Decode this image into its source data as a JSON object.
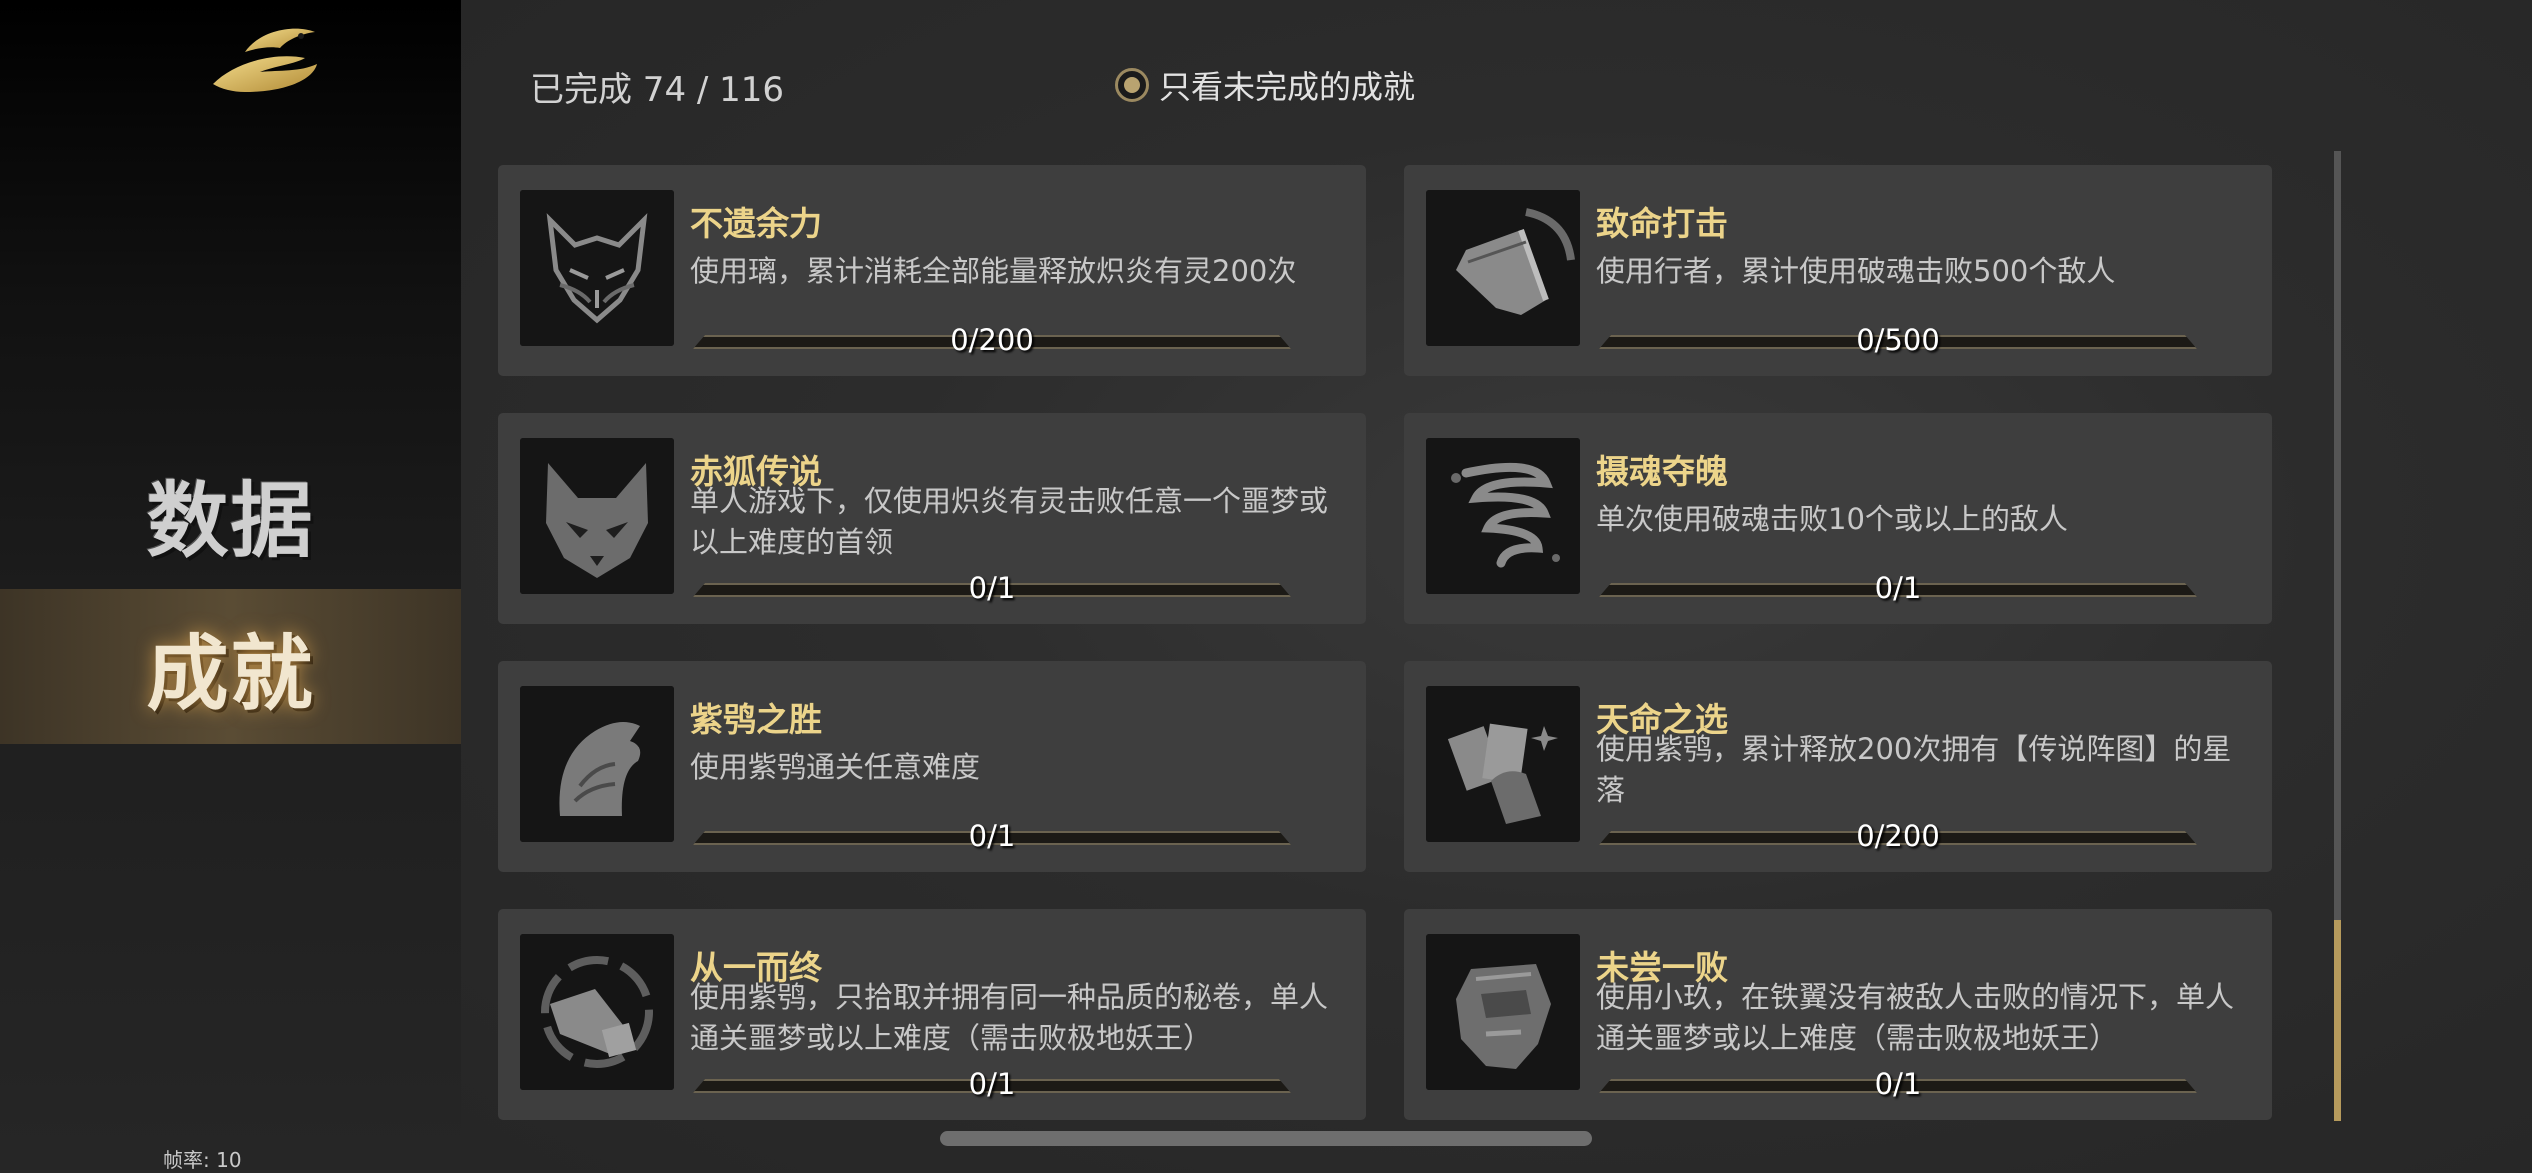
{
  "sidebar": {
    "logo_icon": "dragon-logo-icon",
    "items": [
      {
        "label": "数据",
        "active": false
      },
      {
        "label": "成就",
        "active": true
      }
    ],
    "framerate": "帧率: 10"
  },
  "header": {
    "completed": "已完成 74 / 116",
    "filter_label": "只看未完成的成就",
    "filter_checked": true
  },
  "colors": {
    "accent_gold": "#b69a5c",
    "title_gold": "#ecd48a",
    "card_bg": "#3e3e3e"
  },
  "achievements": [
    {
      "title": "不遗余力",
      "desc": "使用璃，累计消耗全部能量释放炽炎有灵200次",
      "progress": "0/200",
      "fraction": 0,
      "icon": "fox-mask-icon"
    },
    {
      "title": "致命打击",
      "desc": "使用行者，累计使用破魂击败500个敌人",
      "progress": "0/500",
      "fraction": 0,
      "icon": "hammer-strike-icon"
    },
    {
      "title": "赤狐传说",
      "desc": "单人游戏下，仅使用炽炎有灵击败任意一个噩梦或以上难度的首领",
      "progress": "0/1",
      "fraction": 0,
      "icon": "fox-face-icon"
    },
    {
      "title": "摄魂夺魄",
      "desc": "单次使用破魂击败10个或以上的敌人",
      "progress": "0/1",
      "fraction": 0,
      "icon": "vortex-icon"
    },
    {
      "title": "紫鸮之胜",
      "desc": "使用紫鸮通关任意难度",
      "progress": "0/1",
      "fraction": 0,
      "icon": "owl-head-icon"
    },
    {
      "title": "天命之选",
      "desc": "使用紫鸮，累计释放200次拥有【传说阵图】的星落",
      "progress": "0/200",
      "fraction": 0,
      "icon": "cards-hand-icon"
    },
    {
      "title": "从一而终",
      "desc": "使用紫鸮，只拾取并拥有同一种品质的秘卷，单人通关噩梦或以上难度（需击败极地妖王）",
      "progress": "0/1",
      "fraction": 0,
      "icon": "scroll-cycle-icon"
    },
    {
      "title": "未尝一败",
      "desc": "使用小玖，在铁翼没有被敌人击败的情况下，单人通关噩梦或以上难度（需击败极地妖王）",
      "progress": "0/1",
      "fraction": 0,
      "icon": "armored-fist-icon"
    }
  ]
}
